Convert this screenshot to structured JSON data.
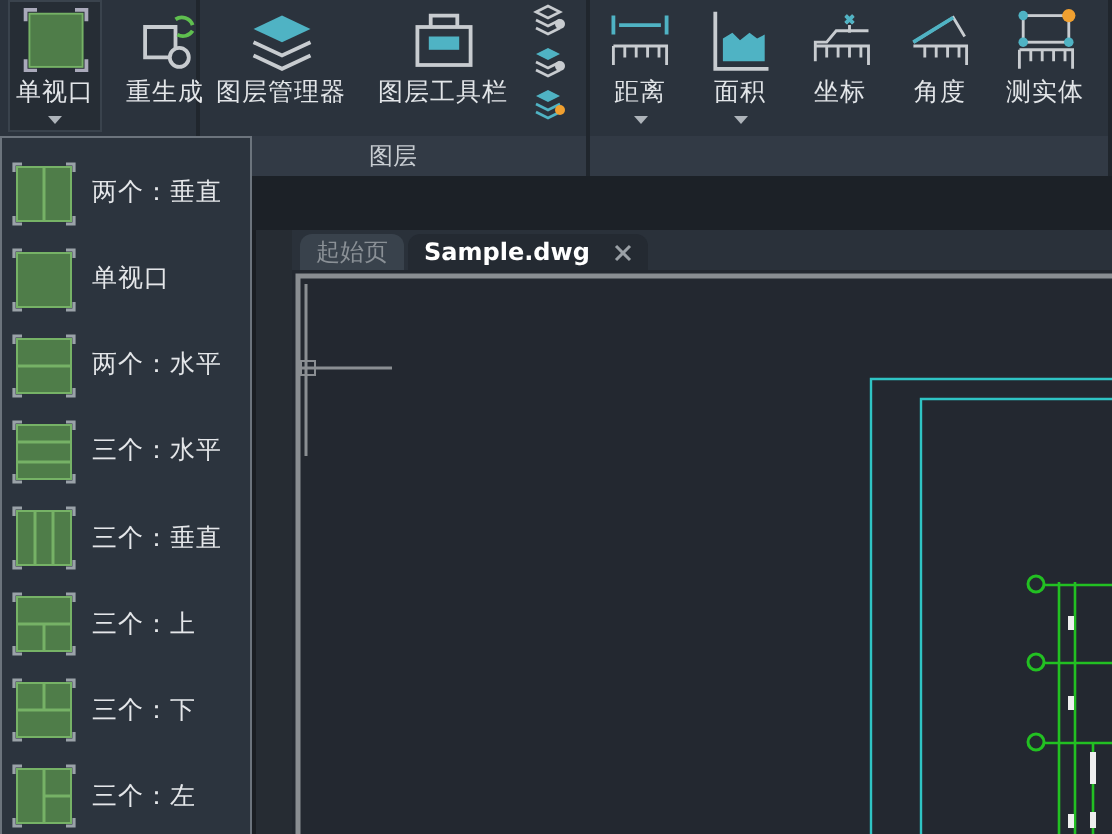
{
  "ribbon": {
    "groups": [
      {
        "tools": [
          {
            "label": "单视口",
            "kind": "viewport",
            "dropdown": true,
            "expanded": true
          },
          {
            "label": "重生成",
            "kind": "regen",
            "dropdown": false,
            "expanded": false
          }
        ]
      },
      {
        "label": "图层",
        "tools": [
          {
            "label": "图层管理器",
            "kind": "layers",
            "dropdown": false,
            "expanded": false
          },
          {
            "label": "图层工具栏",
            "kind": "layer-toolbar",
            "dropdown": false,
            "expanded": false
          }
        ],
        "small_tools": [
          {
            "kind": "layer-gear"
          },
          {
            "kind": "layer-gear-blue"
          },
          {
            "kind": "layer-bulb"
          }
        ]
      },
      {
        "tools": [
          {
            "label": "距离",
            "kind": "distance",
            "dropdown": true,
            "expanded": false
          },
          {
            "label": "面积",
            "kind": "area",
            "dropdown": true,
            "expanded": false
          },
          {
            "label": "坐标",
            "kind": "coordinate",
            "dropdown": false,
            "expanded": false
          },
          {
            "label": "角度",
            "kind": "angle",
            "dropdown": false,
            "expanded": false
          },
          {
            "label": "测实体",
            "kind": "entity",
            "dropdown": false,
            "expanded": false
          }
        ]
      }
    ]
  },
  "viewport_menu": {
    "items": [
      {
        "label": "两个：垂直",
        "kind": "two-vertical"
      },
      {
        "label": "单视口",
        "kind": "single"
      },
      {
        "label": "两个：水平",
        "kind": "two-horizontal"
      },
      {
        "label": "三个：水平",
        "kind": "three-horizontal"
      },
      {
        "label": "三个：垂直",
        "kind": "three-vertical"
      },
      {
        "label": "三个：上",
        "kind": "three-top"
      },
      {
        "label": "三个：下",
        "kind": "three-bottom"
      },
      {
        "label": "三个：左",
        "kind": "three-left"
      }
    ]
  },
  "document_tabs": [
    {
      "label": "起始页",
      "selected": false,
      "closable": false
    },
    {
      "label": "Sample.dwg",
      "selected": true,
      "closable": true
    }
  ]
}
